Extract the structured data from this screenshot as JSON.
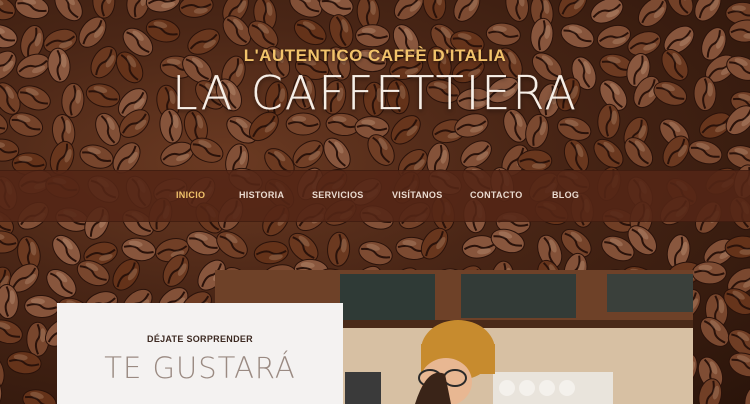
{
  "header": {
    "tagline": "L'AUTENTICO CAFFÈ D'ITALIA",
    "brand": "LA CAFFETTIERA"
  },
  "nav": {
    "items": [
      {
        "label": "INICIO",
        "active": true
      },
      {
        "label": "HISTORIA",
        "active": false
      },
      {
        "label": "SERVICIOS",
        "active": false
      },
      {
        "label": "VISÍTANOS",
        "active": false
      },
      {
        "label": "CONTACTO",
        "active": false
      },
      {
        "label": "BLOG",
        "active": false
      }
    ]
  },
  "promo": {
    "kicker": "DÉJATE SORPRENDER",
    "title": "TE GUSTARÁ"
  },
  "colors": {
    "accent": "#f2c36b",
    "nav_bg": "#542616",
    "brand_text": "#f7efe7"
  }
}
